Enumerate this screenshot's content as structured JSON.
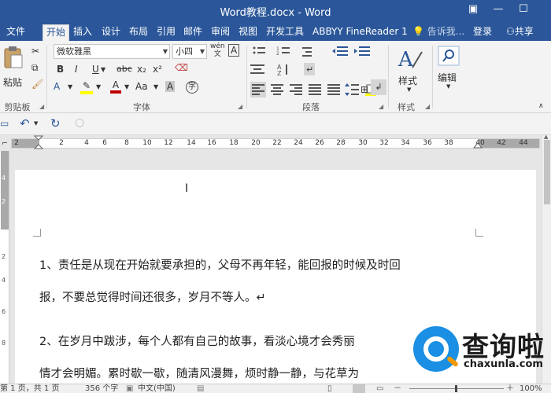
{
  "window": {
    "title": "Word教程.docx - Word",
    "controls": [
      "▣",
      "—",
      "☐"
    ]
  },
  "tabs": [
    {
      "label": "文件"
    },
    {
      "label": "开始"
    },
    {
      "label": "插入"
    },
    {
      "label": "设计"
    },
    {
      "label": "布局"
    },
    {
      "label": "引用"
    },
    {
      "label": "邮件"
    },
    {
      "label": "审阅"
    },
    {
      "label": "视图"
    },
    {
      "label": "开发工具"
    },
    {
      "label": "ABBYY FineReader 1"
    }
  ],
  "tellme": "告诉我...",
  "login": "登录",
  "share": "共享",
  "ribbon": {
    "clipboard": {
      "paste_label": "粘贴",
      "group_label": "剪贴板"
    },
    "font": {
      "font_name": "微软雅黑",
      "font_size": "小四",
      "group_label": "字体",
      "bold": "B",
      "italic": "I",
      "underline": "U",
      "strike": "abc",
      "sub": "x₂",
      "sup": "x²",
      "font_color_a": "A",
      "highlight_a": "A",
      "size_aa": "Aa",
      "grow_a": "A",
      "wen": "wén",
      "circle_char": "字"
    },
    "paragraph": {
      "group_label": "段落"
    },
    "styles": {
      "label": "样式",
      "group_label": "样式"
    },
    "editing": {
      "label": "编辑"
    }
  },
  "ruler": {
    "ticks": [
      "2",
      "2",
      "4",
      "6",
      "8",
      "10",
      "12",
      "14",
      "16",
      "18",
      "20",
      "22",
      "24",
      "26",
      "28",
      "30",
      "32",
      "34",
      "36",
      "38",
      "40",
      "42",
      "44"
    ]
  },
  "document": {
    "paragraphs": [
      "1、责任是从现在开始就要承担的，父母不再年轻，能回报的时候及时回",
      "报，不要总觉得时间还很多，岁月不等人。↵",
      "2、在岁月中跋涉，每个人都有自己的故事，看淡心境才会秀丽",
      "情才会明媚。累时歇一歇，随清风漫舞，烦时静一静，与花草为"
    ]
  },
  "status": {
    "page": "第 1 页，共 1 页",
    "words": "356 个字",
    "language": "中文(中国)",
    "zoom": "100%"
  },
  "watermark": {
    "brand": "查询啦",
    "domain": "chaxunla.com"
  },
  "colors": {
    "brand_blue": "#2b579a",
    "font_color_red": "#c00000",
    "highlight_yellow": "#ffff00"
  }
}
